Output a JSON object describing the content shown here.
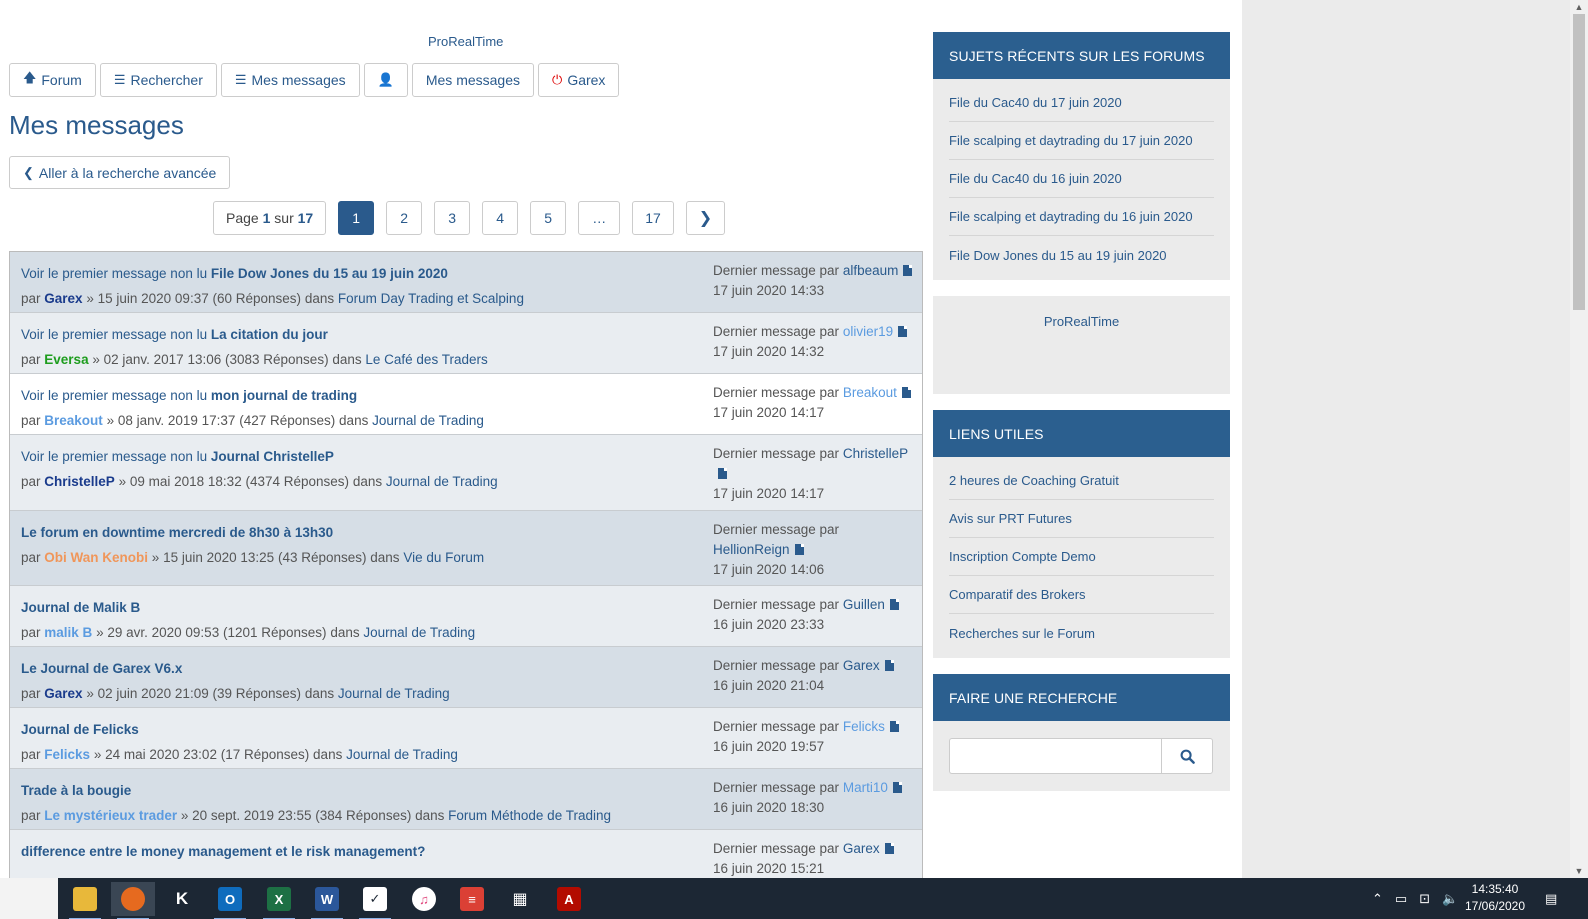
{
  "brand": "ProRealTime",
  "nav": {
    "forum": "Forum",
    "rechercher": "Rechercher",
    "mes_messages_1": "Mes messages",
    "mes_messages_2": "Mes messages",
    "user": "Garex"
  },
  "title": "Mes messages",
  "back_label": "Aller à la recherche avancée",
  "pager": {
    "page_word": "Page",
    "current": "1",
    "of_word": "sur",
    "total": "17",
    "pages": [
      "1",
      "2",
      "3",
      "4",
      "5",
      "…",
      "17"
    ]
  },
  "topics": [
    {
      "pre": "Voir le premier message non lu",
      "title": "File Dow Jones du 15 au 19 juin 2020",
      "author": "Garex",
      "date": "15 juin 2020 09:37",
      "replies": "(60 Réponses)",
      "forum": "Forum Day Trading et Scalping",
      "last_by": "alfbeaum",
      "last_date": "17 juin 2020 14:33"
    },
    {
      "pre": "Voir le premier message non lu",
      "title": "La citation du jour",
      "author": "Eversa",
      "date": "02 janv. 2017 13:06",
      "replies": "(3083 Réponses)",
      "forum": "Le Café des Traders",
      "last_by": "olivier19",
      "last_date": "17 juin 2020 14:32"
    },
    {
      "pre": "Voir le premier message non lu",
      "title": "mon journal de trading",
      "author": "Breakout",
      "date": "08 janv. 2019 17:37",
      "replies": "(427 Réponses)",
      "forum": "Journal de Trading",
      "last_by": "Breakout",
      "last_date": "17 juin 2020 14:17"
    },
    {
      "pre": "Voir le premier message non lu",
      "title": "Journal ChristelleP",
      "author": "ChristelleP",
      "date": "09 mai 2018 18:32",
      "replies": "(4374 Réponses)",
      "forum": "Journal de Trading",
      "last_by": "ChristelleP",
      "last_date": "17 juin 2020 14:17"
    },
    {
      "pre": "",
      "title": "Le forum en downtime mercredi de 8h30 à 13h30",
      "author": "Obi Wan Kenobi",
      "date": "15 juin 2020 13:25",
      "replies": "(43 Réponses)",
      "forum": "Vie du Forum",
      "last_by": "HellionReign",
      "last_date": "17 juin 2020 14:06"
    },
    {
      "pre": "",
      "title": "Journal de Malik B",
      "author": "malik B",
      "date": "29 avr. 2020 09:53",
      "replies": "(1201 Réponses)",
      "forum": "Journal de Trading",
      "last_by": "Guillen",
      "last_date": "16 juin 2020 23:33"
    },
    {
      "pre": "",
      "title": "Le Journal de Garex V6.x",
      "author": "Garex",
      "date": "02 juin 2020 21:09",
      "replies": "(39 Réponses)",
      "forum": "Journal de Trading",
      "last_by": "Garex",
      "last_date": "16 juin 2020 21:04"
    },
    {
      "pre": "",
      "title": "Journal de Felicks",
      "author": "Felicks",
      "date": "24 mai 2020 23:02",
      "replies": "(17 Réponses)",
      "forum": "Journal de Trading",
      "last_by": "Felicks",
      "last_date": "16 juin 2020 19:57"
    },
    {
      "pre": "",
      "title": "Trade à la bougie",
      "author": "Le mystérieux trader",
      "date": "20 sept. 2019 23:55",
      "replies": "(384 Réponses)",
      "forum": "Forum Méthode de Trading",
      "last_by": "Marti10",
      "last_date": "16 juin 2020 18:30"
    },
    {
      "pre": "",
      "title": "difference entre le money management et le risk management?",
      "author": "",
      "date": "",
      "replies": "",
      "forum": "",
      "last_by": "Garex",
      "last_date": "16 juin 2020 15:21"
    }
  ],
  "labels": {
    "par": "par",
    "sep": "»",
    "dans": "dans",
    "last_prefix": "Dernier message par"
  },
  "sidebar": {
    "recent_title": "SUJETS RÉCENTS SUR LES FORUMS",
    "recent": [
      "File du Cac40 du 17 juin 2020",
      "File scalping et daytrading du 17 juin 2020",
      "File du Cac40 du 16 juin 2020",
      "File scalping et daytrading du 16 juin 2020",
      "File Dow Jones du 15 au 19 juin 2020"
    ],
    "prt_label": "ProRealTime",
    "links_title": "LIENS UTILES",
    "links": [
      "2 heures de Coaching Gratuit",
      "Avis sur PRT Futures",
      "Inscription Compte Demo",
      "Comparatif des Brokers",
      "Recherches sur le Forum"
    ],
    "search_title": "FAIRE UNE RECHERCHE",
    "search_value": ""
  },
  "taskbar": {
    "time": "14:35:40",
    "date": "17/06/2020",
    "apps": [
      "file-explorer",
      "firefox",
      "app-k",
      "outlook",
      "excel",
      "word",
      "tasks",
      "itunes",
      "todoist",
      "calculator",
      "acrobat"
    ]
  },
  "colors": {
    "accent": "#2b5f8f",
    "link": "#2a5a8c",
    "row_dark": "#d6dee6",
    "row_light": "#e9edf1"
  }
}
